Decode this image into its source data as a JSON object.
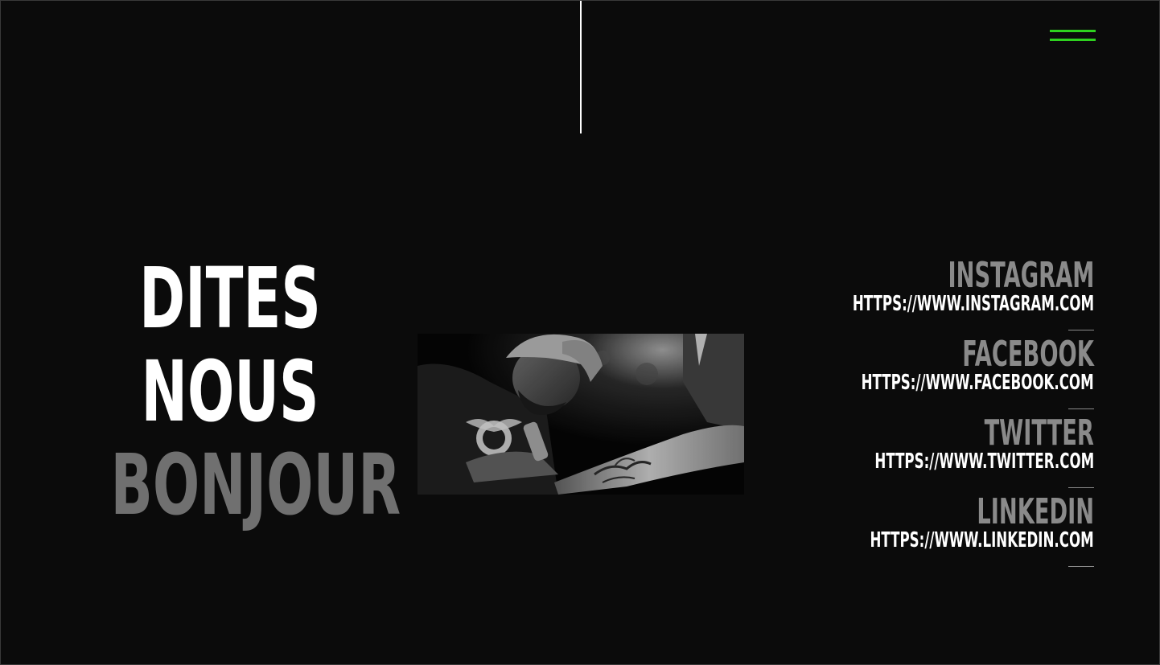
{
  "hero": {
    "line1": "DITES",
    "line2": "NOUS",
    "line3": "BONJOUR"
  },
  "colors": {
    "background": "#0b0b0b",
    "accent": "#2ed11f",
    "muted": "#707070",
    "text": "#ffffff"
  },
  "menu": {
    "icon": "hamburger-menu-icon"
  },
  "photo": {
    "subject": "tattoo-artist-photo"
  },
  "socials": [
    {
      "name": "INSTAGRAM",
      "url": "HTTPS://WWW.INSTAGRAM.COM"
    },
    {
      "name": "FACEBOOK",
      "url": "HTTPS://WWW.FACEBOOK.COM"
    },
    {
      "name": "TWITTER",
      "url": "HTTPS://WWW.TWITTER.COM"
    },
    {
      "name": "LINKEDIN",
      "url": "HTTPS://WWW.LINKEDIN.COM"
    }
  ]
}
